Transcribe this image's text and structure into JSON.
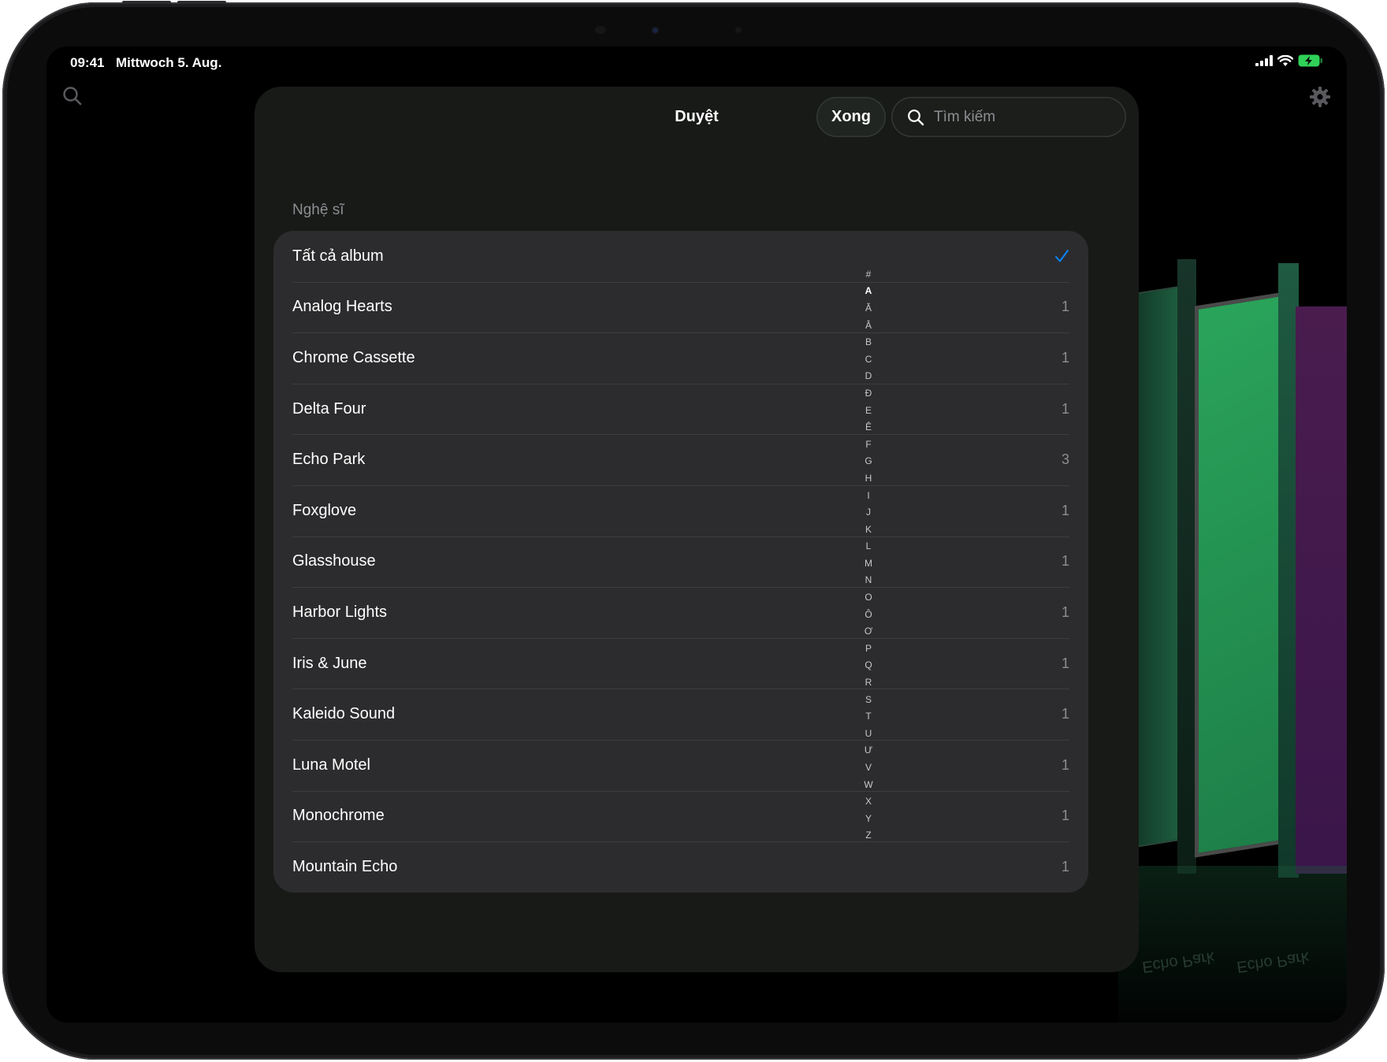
{
  "status_bar": {
    "time": "09:41",
    "date": "Mittwoch 5. Aug.",
    "icons": [
      "signal-icon",
      "wifi-icon",
      "battery-charging-icon"
    ]
  },
  "background": {
    "search_icon": "search-icon",
    "settings_icon": "gear-icon",
    "reflection_labels": [
      "Echo Park",
      "Echo Park"
    ]
  },
  "sheet": {
    "title": "Duyệt",
    "done_label": "Xong",
    "search_placeholder": "Tìm kiếm",
    "section_title": "Nghệ sĩ",
    "rows": [
      {
        "label": "Tất cả album",
        "count": "",
        "selected": true
      },
      {
        "label": "Analog Hearts",
        "count": "1"
      },
      {
        "label": "Chrome Cassette",
        "count": "1"
      },
      {
        "label": "Delta Four",
        "count": "1"
      },
      {
        "label": "Echo Park",
        "count": "3"
      },
      {
        "label": "Foxglove",
        "count": "1"
      },
      {
        "label": "Glasshouse",
        "count": "1"
      },
      {
        "label": "Harbor Lights",
        "count": "1"
      },
      {
        "label": "Iris & June",
        "count": "1"
      },
      {
        "label": "Kaleido Sound",
        "count": "1"
      },
      {
        "label": "Luna Motel",
        "count": "1"
      },
      {
        "label": "Monochrome",
        "count": "1"
      },
      {
        "label": "Mountain Echo",
        "count": "1"
      }
    ]
  },
  "index": {
    "letters": [
      "#",
      "A",
      "Ă",
      "Â",
      "B",
      "C",
      "D",
      "Đ",
      "E",
      "Ê",
      "F",
      "G",
      "H",
      "I",
      "J",
      "K",
      "L",
      "M",
      "N",
      "O",
      "Ô",
      "Ơ",
      "P",
      "Q",
      "R",
      "S",
      "T",
      "U",
      "Ư",
      "V",
      "W",
      "X",
      "Y",
      "Z"
    ],
    "active": "A"
  },
  "colors": {
    "accent": "#0a84ff",
    "sheet_bg": "#181a18",
    "card_bg": "#2c2c2e",
    "secondary_text": "#8d8d92"
  }
}
